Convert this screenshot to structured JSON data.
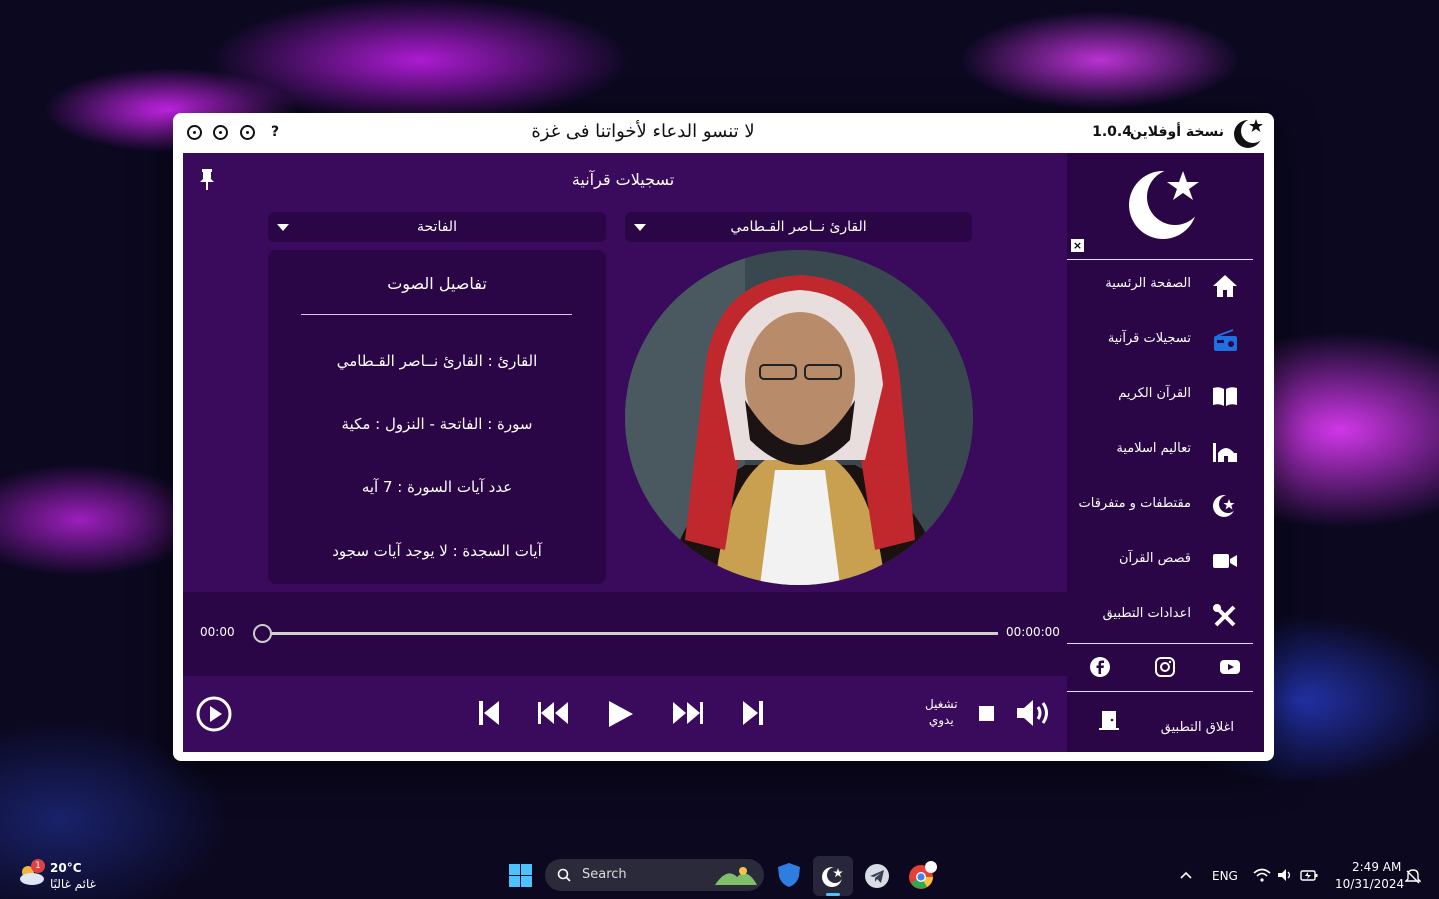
{
  "titlebar": {
    "help": "?",
    "message": "لا تنسو الدعاء لأخواتنا فى غزة",
    "version": "1.0.4",
    "app_name": "نسخة أوفلاين"
  },
  "main": {
    "section_title": "تسجيلات قرآنية",
    "surah_select": "الفاتحة",
    "reciter_select": "القارئ نــاصر القـطامي",
    "info": {
      "title": "تفاصيل الصوت",
      "reciter": "القارئ : القارئ نــاصر القـطامي",
      "surah": "سورة  :  الفاتحة  -  النزول  :  مكية",
      "ayat_count": "عدد آيات السورة  :  7  آيه",
      "sajda": "آيات السجدة  :  لا يوجد آيات سجود"
    }
  },
  "player": {
    "current_time": "00:00",
    "total_time": "00:00:00",
    "progress": 0,
    "mode_line1": "تشغيل",
    "mode_line2": "يدوي"
  },
  "sidebar": {
    "close": "×",
    "items": [
      {
        "label": "الصفحة الرئسية",
        "icon": "home-icon"
      },
      {
        "label": "تسجيلات قرآنية",
        "icon": "radio-icon"
      },
      {
        "label": "القرآن الكريم",
        "icon": "book-icon"
      },
      {
        "label": "تعاليم اسلامية",
        "icon": "mosque-icon"
      },
      {
        "label": "مقتطفات و متفرقات",
        "icon": "crescent-star-icon"
      },
      {
        "label": "قصص القرآن",
        "icon": "video-icon"
      },
      {
        "label": "اعدادات التطبيق",
        "icon": "tools-icon"
      }
    ],
    "exit_label": "اغلاق التطبيق"
  },
  "taskbar": {
    "weather_temp": "20°C",
    "weather_desc": "غائم غالبًا",
    "weather_badge": "1",
    "search_placeholder": "Search",
    "lang": "ENG",
    "time": "2:49 AM",
    "date": "10/31/2024"
  },
  "colors": {
    "panel": "#3a0a5c",
    "panel_dark": "#2b0646",
    "accent_icon": "#1f6fe0"
  }
}
